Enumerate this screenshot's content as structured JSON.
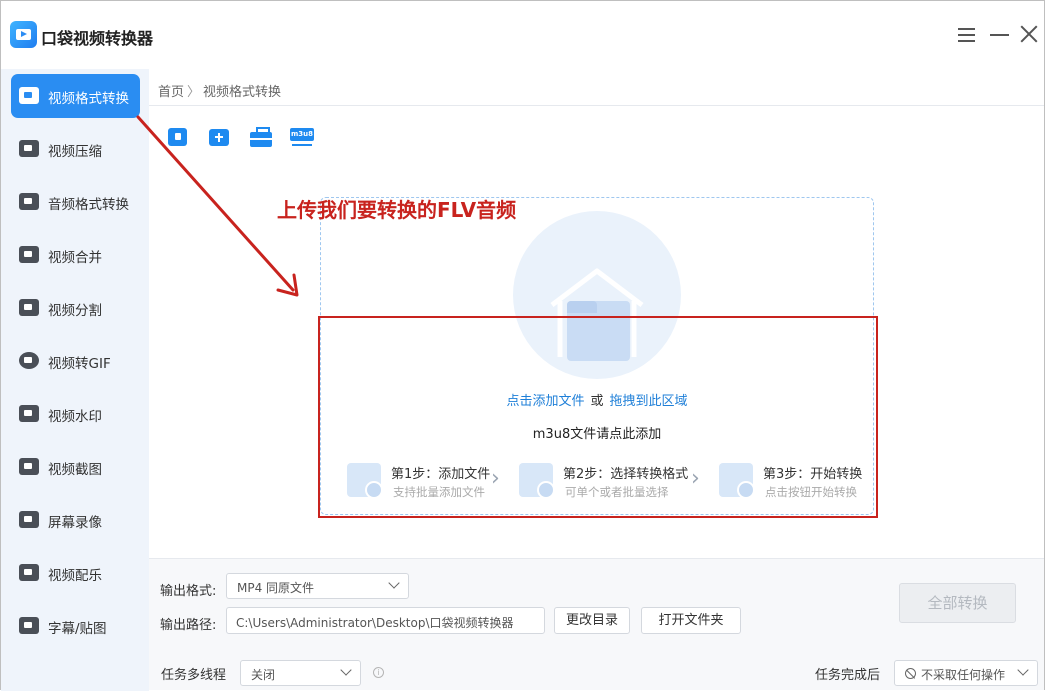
{
  "app": {
    "title": "口袋视频转换器"
  },
  "sidebar": {
    "items": [
      {
        "label": "视频格式转换",
        "icon": "video-convert-icon",
        "active": true
      },
      {
        "label": "视频压缩",
        "icon": "video-compress-icon"
      },
      {
        "label": "音频格式转换",
        "icon": "audio-convert-icon"
      },
      {
        "label": "视频合并",
        "icon": "video-merge-icon"
      },
      {
        "label": "视频分割",
        "icon": "video-split-icon"
      },
      {
        "label": "视频转GIF",
        "icon": "gif-icon"
      },
      {
        "label": "视频水印",
        "icon": "watermark-icon"
      },
      {
        "label": "视频截图",
        "icon": "screenshot-icon"
      },
      {
        "label": "屏幕录像",
        "icon": "screen-record-icon"
      },
      {
        "label": "视频配乐",
        "icon": "music-icon"
      },
      {
        "label": "字幕/贴图",
        "icon": "subtitle-icon"
      }
    ]
  },
  "breadcrumb": {
    "home": "首页",
    "separator": "〉",
    "current": "视频格式转换"
  },
  "toolbar": {
    "m3u8_label": "m3u8"
  },
  "annotation": {
    "text": "上传我们要转换的FLV音频",
    "color": "#c8231e"
  },
  "dropzone": {
    "add_file": "点击添加文件",
    "or": "或",
    "drag_here": "拖拽到此区域",
    "m3u8_hint": "m3u8文件请点此添加"
  },
  "steps": [
    {
      "title": "第1步：添加文件",
      "subtitle": "支持批量添加文件"
    },
    {
      "title": "第2步：选择转换格式",
      "subtitle": "可单个或者批量选择"
    },
    {
      "title": "第3步：开始转换",
      "subtitle": "点击按钮开始转换"
    }
  ],
  "bottom": {
    "output_format_label": "输出格式:",
    "output_format_value": "MP4  同原文件",
    "output_path_label": "输出路径:",
    "output_path_value": "C:\\Users\\Administrator\\Desktop\\口袋视频转换器",
    "change_dir_button": "更改目录",
    "open_folder_button": "打开文件夹",
    "convert_all_button": "全部转换",
    "multithread_label": "任务多线程",
    "multithread_value": "关闭",
    "info_glyph": "i",
    "after_complete_label": "任务完成后",
    "after_complete_value": "不采取任何操作"
  },
  "colors": {
    "accent": "#2a8df2",
    "sidebar_bg": "#eff4fb",
    "annotation": "#c8231e",
    "link": "#1e7fd8"
  }
}
